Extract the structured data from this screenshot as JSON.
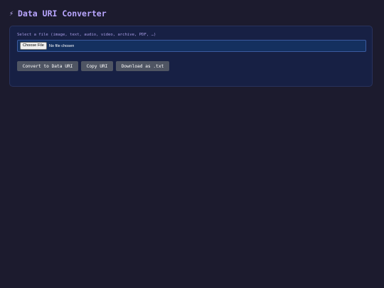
{
  "header": {
    "title": "Data URI Converter",
    "icon": "lightning-bolt-icon",
    "icon_glyph": "⚡"
  },
  "file_picker": {
    "label": "Select a file (image, text, audio, video, archive, PDF, …)",
    "button_label": "Choose File",
    "status": "No file chosen"
  },
  "actions": {
    "convert_label": "Convert to Data URI",
    "copy_label": "Copy URI",
    "download_label": "Download as .txt"
  },
  "colors": {
    "background": "#1c1b2e",
    "panel": "#172044",
    "accent": "#b9a6ff",
    "button": "#4f5563"
  }
}
